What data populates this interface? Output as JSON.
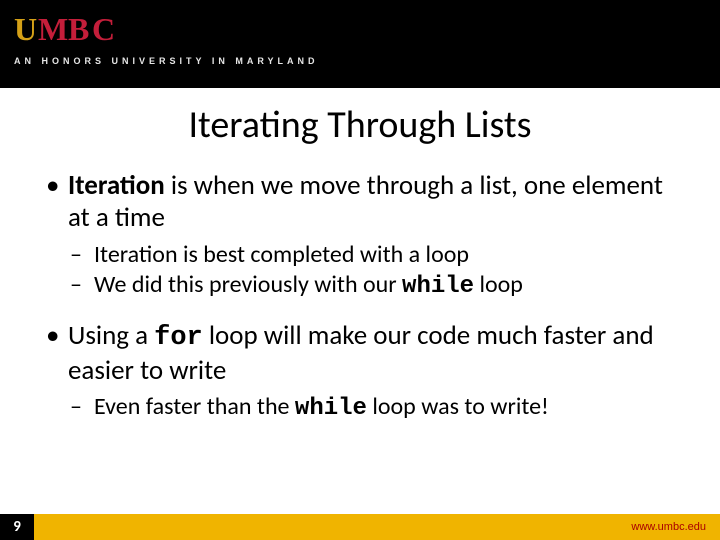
{
  "header": {
    "logo_text": "UMBC",
    "tagline": "AN HONORS UNIVERSITY IN MARYLAND"
  },
  "title": "Iterating Through Lists",
  "bullets": [
    {
      "bold_lead": "Iteration",
      "rest": " is when we move through a list, one element at a time",
      "subs": [
        {
          "pre": "Iteration is best completed with a loop",
          "code": "",
          "post": ""
        },
        {
          "pre": "We did this previously with our ",
          "code": "while",
          "post": " loop"
        }
      ]
    },
    {
      "pre": "Using a ",
      "code": "for",
      "post": " loop will make our code much faster and easier to write",
      "subs": [
        {
          "pre": "Even faster than the ",
          "code": "while",
          "post": " loop was to write!"
        }
      ]
    }
  ],
  "footer": {
    "page_number": "9",
    "url": "www.umbc.edu"
  }
}
